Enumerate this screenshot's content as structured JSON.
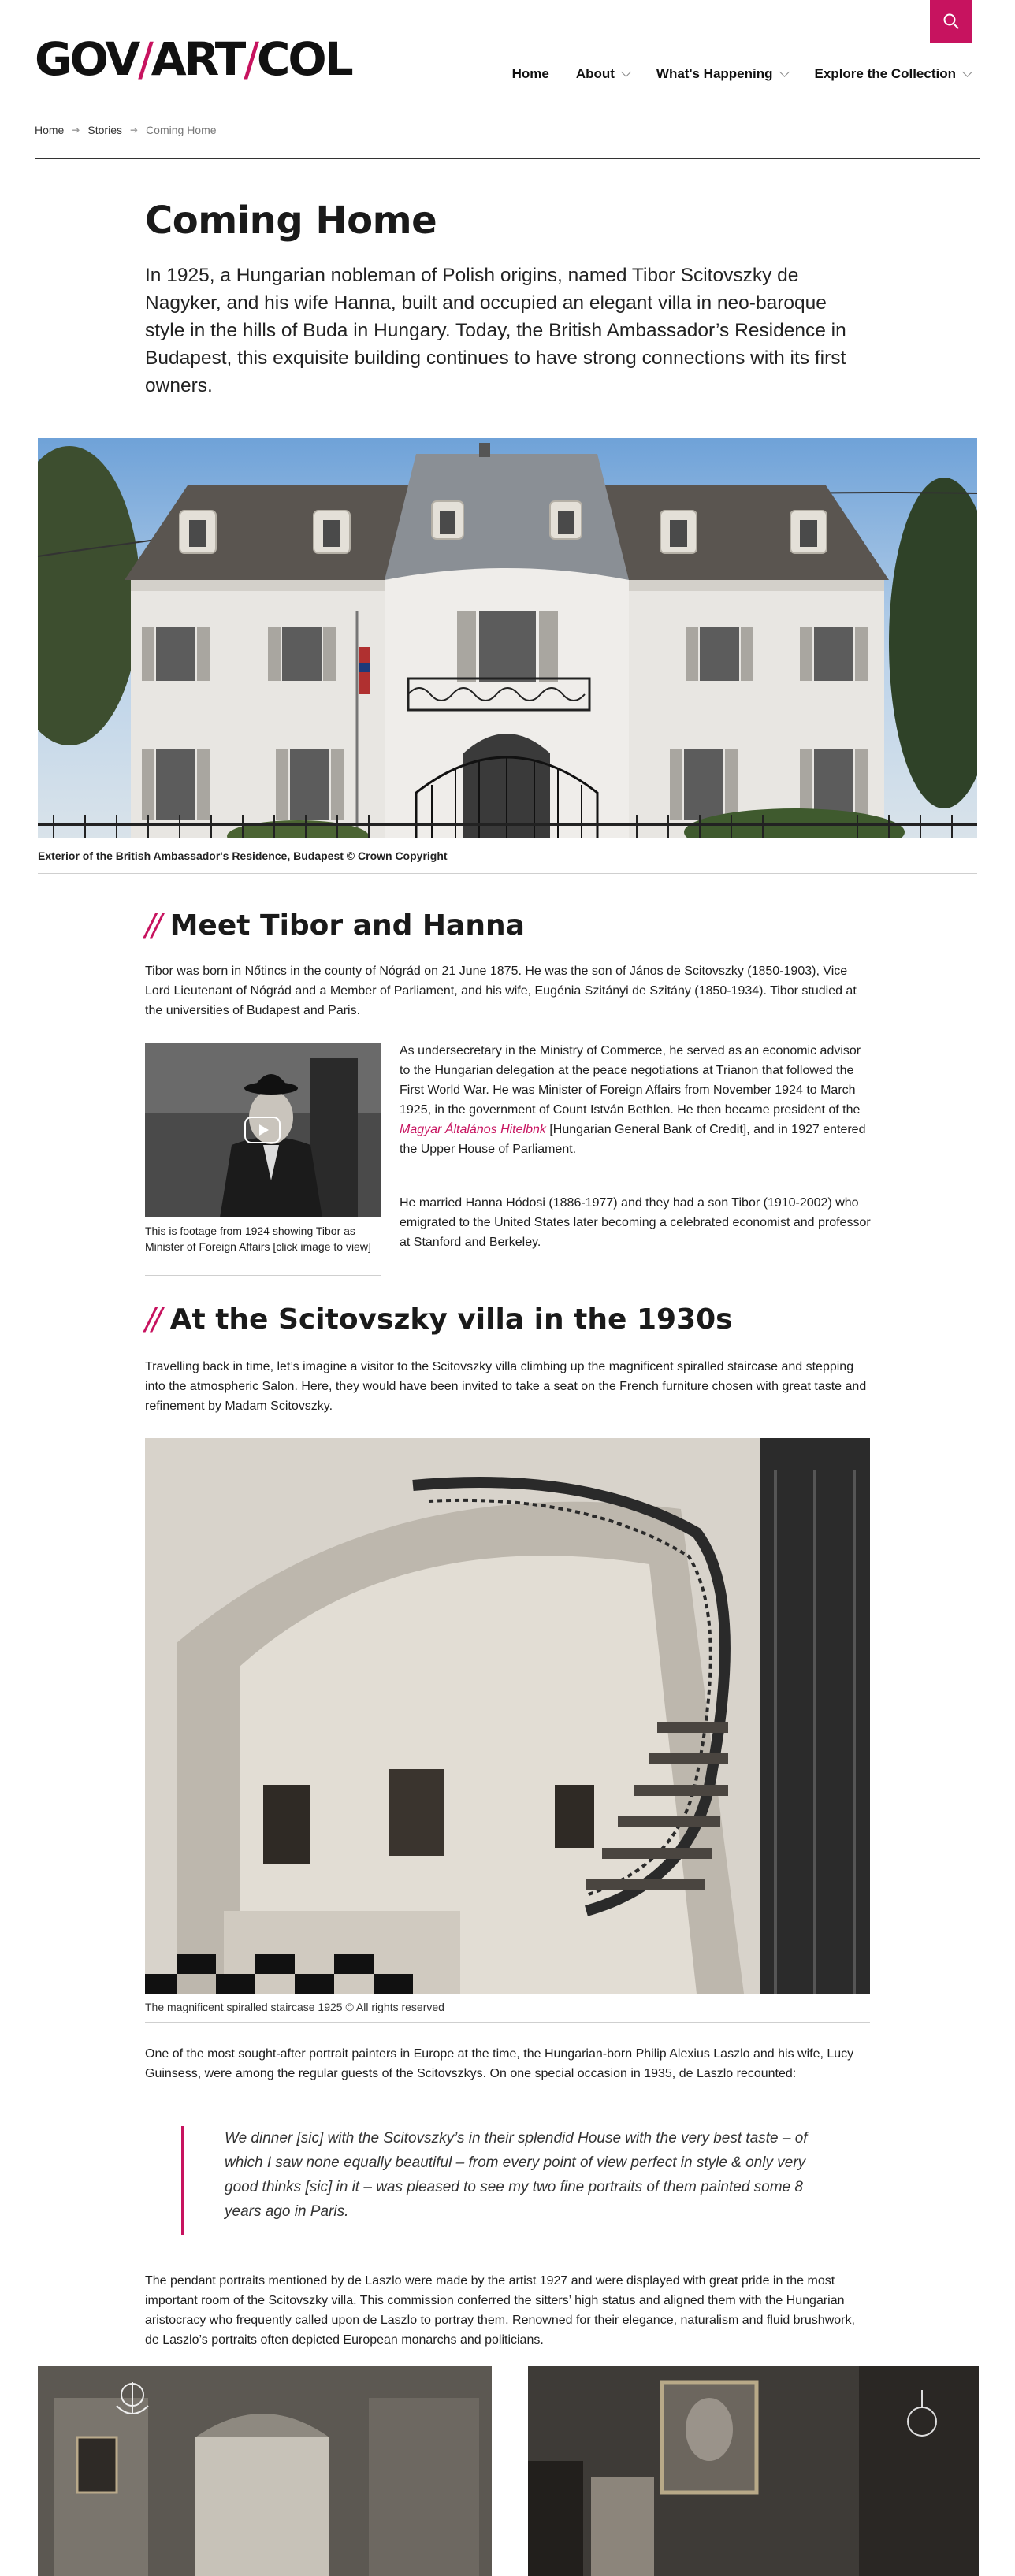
{
  "header": {
    "logo": {
      "part1": "GOV",
      "part2": "ART",
      "part3": "COL"
    },
    "search_icon": "search-icon",
    "nav": [
      {
        "label": "Home",
        "has_dropdown": false
      },
      {
        "label": "About",
        "has_dropdown": true
      },
      {
        "label": "What's Happening",
        "has_dropdown": true
      },
      {
        "label": "Explore the Collection",
        "has_dropdown": true
      }
    ],
    "accent_color": "#c7135f"
  },
  "breadcrumb": [
    "Home",
    "Stories",
    "Coming Home"
  ],
  "article": {
    "title": "Coming Home",
    "lede": "In 1925, a Hungarian nobleman of Polish origins, named Tibor Scitovszky de Nagyker, and his wife Hanna, built and occupied an elegant villa in neo-baroque style in the hills of Buda in Hungary. Today, the British Ambassador’s Residence in Budapest, this exquisite building continues to have strong connections with its first owners.",
    "hero_caption": "Exterior of the British Ambassador's Residence, Budapest © Crown Copyright",
    "section1": {
      "heading": "Meet Tibor and Hanna",
      "p1": "Tibor was born in Nőtincs in the county of Nógrád on 21 June 1875. He was the son of János de Scitovszky (1850-1903), Vice Lord Lieutenant of Nógrád and a Member of Parliament, and his wife, Eugénia Szitányi de Szitány (1850-1934). Tibor studied at the universities of Budapest and Paris.",
      "video_caption": "This is footage from 1924 showing Tibor as Minister of Foreign Affairs [click image to view]",
      "p2_before": "As undersecretary in the Ministry of Commerce, he served as an economic advisor to the Hungarian delegation at the peace negotiations at Trianon that followed the First World War. He was Minister of Foreign Affairs from November 1924 to March 1925, in the government of Count István Bethlen. He then became president of the ",
      "p2_link": "Magyar Általános Hitelbnk",
      "p2_after": " [Hungarian General Bank of Credit], and in 1927 entered the Upper House of Parliament.",
      "p3": "He married Hanna Hódosi (1886-1977) and they had a son Tibor (1910-2002) who emigrated to the United States later becoming a celebrated economist and professor at Stanford and Berkeley."
    },
    "section2": {
      "heading": "At the Scitovszky villa in the 1930s",
      "p1": "Travelling back in time, let’s imagine a visitor to the Scitovszky villa climbing up the magnificent spiralled staircase and stepping into the atmospheric Salon. Here, they would have been invited to take a seat on the French furniture chosen with great taste and refinement by Madam Scitovszky.",
      "stair_caption": "The magnificent spiralled staircase 1925 © All rights reserved",
      "p2": "One of the most sought-after portrait painters in Europe at the time, the Hungarian-born Philip Alexius Laszlo and his wife, Lucy Guinsess, were among the regular guests of the Scitovszkys. On one special occasion in 1935, de Laszlo recounted:",
      "quote": "We dinner [sic] with the Scitovszky’s in their splendid House with the very best taste – of which I saw none equally beautiful – from every point of view perfect in style & only very good thinks [sic] in it – was pleased to see my two fine portraits of them painted some 8 years ago in Paris.",
      "p3": "The pendant portraits mentioned by de Laszlo were made by the artist 1927 and were displayed with great pride in the most important room of the Scitovszky villa. This commission conferred the sitters’ high status and aligned them with the Hungarian aristocracy who frequently called upon de Laszlo to portray them. Renowned for their elegance, naturalism and fluid brushwork, de Laszlo’s portraits often depicted European monarchs and politicians."
    }
  }
}
